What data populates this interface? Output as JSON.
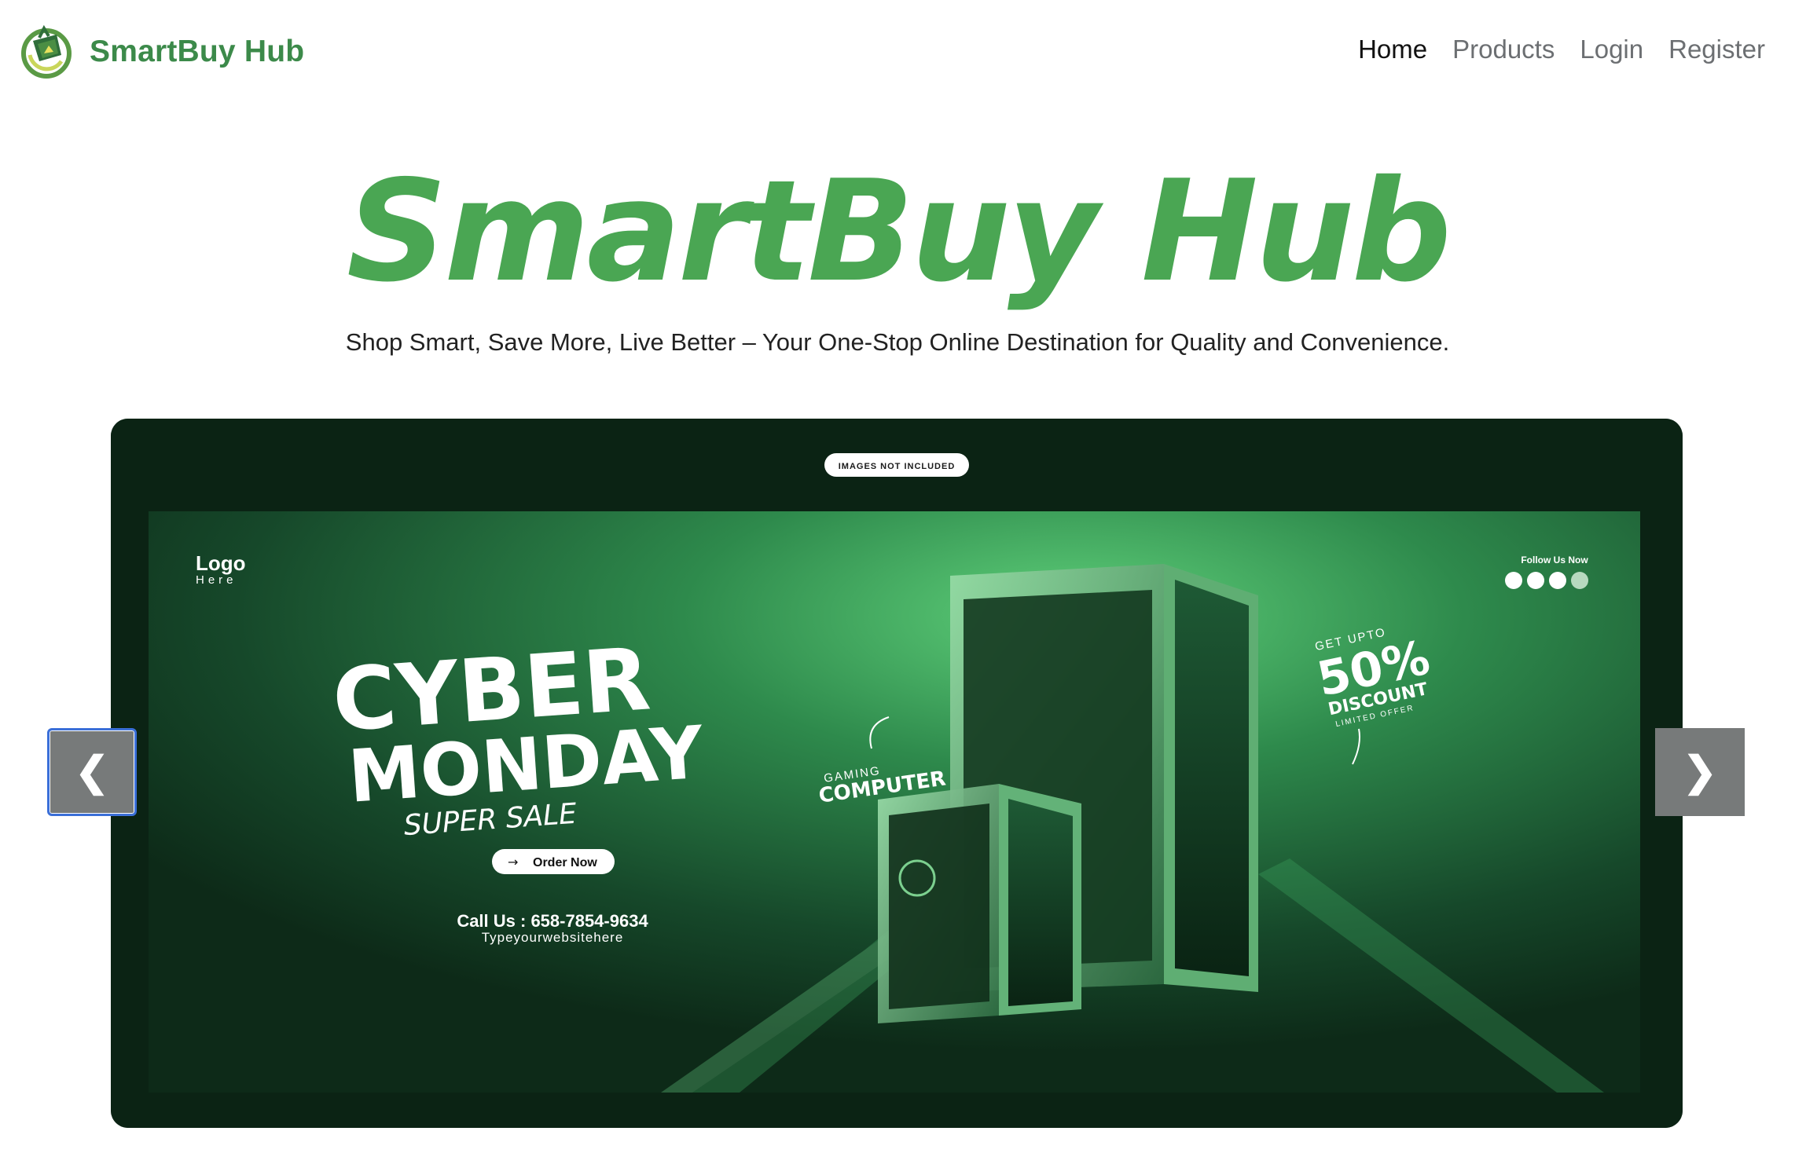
{
  "navbar": {
    "brand_name": "SmartBuy Hub",
    "logo_icon": "shopping-tag-logo-icon",
    "links": [
      {
        "label": "Home",
        "active": true
      },
      {
        "label": "Products",
        "active": false
      },
      {
        "label": "Login",
        "active": false
      },
      {
        "label": "Register",
        "active": false
      }
    ]
  },
  "hero": {
    "title": "SmartBuy Hub",
    "subtitle": "Shop Smart, Save More, Live Better – Your One-Stop Online Destination for Quality and Convenience."
  },
  "carousel": {
    "prev_label": "❮",
    "next_label": "❯",
    "prev_icon": "chevron-left-icon",
    "next_icon": "chevron-right-icon",
    "slide": {
      "badge": "IMAGES NOT INCLUDED",
      "logo_line1": "Logo",
      "logo_line2": "Here",
      "headline1": "CYBER",
      "headline2": "MONDAY",
      "headline3": "SUPER SALE",
      "cta": "Order Now",
      "phone": "Call Us : 658-7854-9634",
      "website": "Typeyourwebsitehere",
      "gaming_line1": "GAMING",
      "gaming_line2": "COMPUTER",
      "follow": "Follow Us Now",
      "offer_line1": "GET UPTO",
      "offer_line2": "50%",
      "offer_line3": "DISCOUNT",
      "offer_line4": "LIMITED OFFER"
    }
  },
  "colors": {
    "brand_green": "#3c8a4a",
    "hero_green": "#4aa653",
    "banner_dark": "#0b2314",
    "banner_green": "#2e7d45",
    "focus_ring": "#3b6fd8"
  }
}
